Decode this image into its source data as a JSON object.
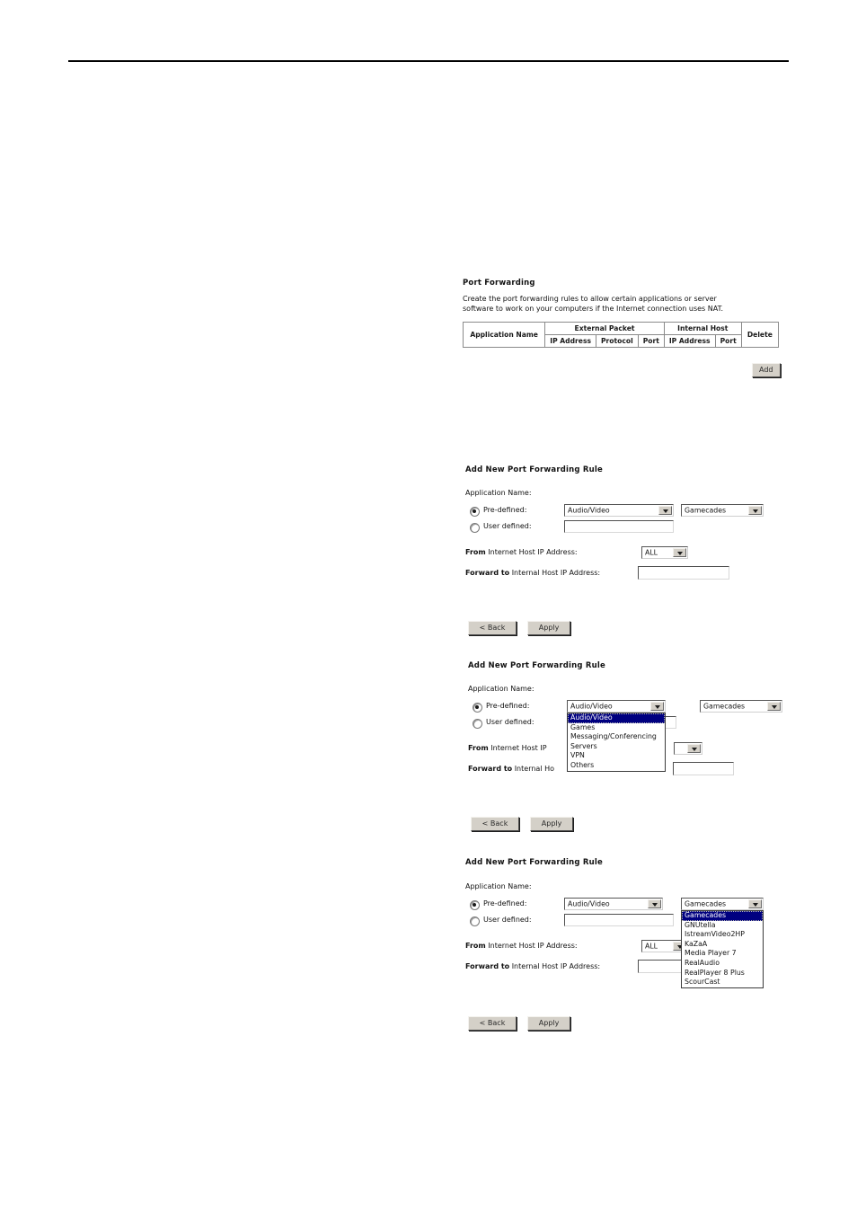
{
  "document": {
    "has_header_rule": true
  },
  "figure1": {
    "title": "Port Forwarding",
    "description_line1": "Create the port forwarding rules to allow certain applications or server",
    "description_line2": "software to work on your computers if the Internet connection uses NAT.",
    "table": {
      "group_headers": {
        "application_name": "Application Name",
        "external_packet": "External Packet",
        "internal_host": "Internal Host",
        "delete": "Delete"
      },
      "sub_headers": {
        "external_ip_address": "IP Address",
        "external_protocol": "Protocol",
        "external_port": "Port",
        "internal_ip_address": "IP Address",
        "internal_port": "Port"
      },
      "rows": []
    },
    "add_button": "Add"
  },
  "figure2": {
    "title": "Add New Port Forwarding Rule",
    "application_name_label": "Application Name:",
    "predefined_label": "Pre-defined:",
    "predefined_selected": true,
    "user_defined_label": "User defined:",
    "user_defined_selected": false,
    "user_defined_value": "",
    "category_combo_value": "Audio/Video",
    "application_combo_value": "Gamecades",
    "from_label_bold": "From",
    "from_label_rest": " Internet Host IP Address:",
    "from_combo_value": "ALL",
    "forward_label_bold": "Forward to",
    "forward_label_rest": " Internal Host IP Address:",
    "forward_value": "",
    "back_button": "< Back",
    "apply_button": "Apply"
  },
  "figure3": {
    "title": "Add New Port Forwarding Rule",
    "application_name_label": "Application Name:",
    "predefined_label": "Pre-defined:",
    "predefined_selected": true,
    "user_defined_label": "User defined:",
    "user_defined_selected": false,
    "user_defined_value": "",
    "category_combo_value": "Audio/Video",
    "application_combo_value": "Gamecades",
    "from_label_bold": "From",
    "from_label_rest": " Internet Host IP ",
    "from_combo_value": "",
    "forward_label_bold": "Forward to",
    "forward_label_rest": " Internal Ho",
    "forward_value": "",
    "category_options": [
      "Audio/Video",
      "Games",
      "Messaging/Conferencing",
      "Servers",
      "VPN",
      "Others"
    ],
    "category_selected_index": 0,
    "back_button": "< Back",
    "apply_button": "Apply"
  },
  "figure4": {
    "title": "Add New Port Forwarding Rule",
    "application_name_label": "Application Name:",
    "predefined_label": "Pre-defined:",
    "predefined_selected": true,
    "user_defined_label": "User defined:",
    "user_defined_selected": false,
    "user_defined_value": "",
    "category_combo_value": "Audio/Video",
    "application_combo_value": "Gamecades",
    "from_label_bold": "From",
    "from_label_rest": " Internet Host IP Address:",
    "from_combo_value": "ALL",
    "forward_label_bold": "Forward to",
    "forward_label_rest": " Internal Host IP Address:",
    "forward_value": "",
    "application_options": [
      "Gamecades",
      "GNUtella",
      "IstreamVideo2HP",
      "KaZaA",
      "Media Player 7",
      "RealAudio",
      "RealPlayer 8 Plus",
      "ScourCast"
    ],
    "application_selected_index": 0,
    "back_button": "< Back",
    "apply_button": "Apply"
  },
  "colors": {
    "selection_blue": "#000080",
    "button_face": "#d4d0c8",
    "rule_black": "#000000"
  }
}
